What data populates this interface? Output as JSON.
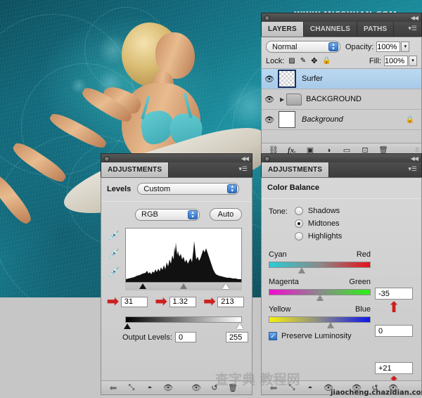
{
  "watermarks": {
    "top": "WWW.MISSYUAN.COM",
    "bottom": "jiaocheng.chazidian.com",
    "bottom_cn": "查字典 教程网"
  },
  "layers_panel": {
    "tabs": [
      {
        "label": "LAYERS",
        "active": true
      },
      {
        "label": "CHANNELS",
        "active": false
      },
      {
        "label": "PATHS",
        "active": false
      }
    ],
    "menu_icon": "panel-menu-icon",
    "blend_mode": "Normal",
    "opacity_label": "Opacity:",
    "opacity_value": "100%",
    "lock_label": "Lock:",
    "lock_icons": [
      "lock-transparency-icon",
      "lock-image-icon",
      "lock-position-icon",
      "lock-all-icon"
    ],
    "fill_label": "Fill:",
    "fill_value": "100%",
    "layers": [
      {
        "name": "Surfer",
        "type": "image",
        "selected": true,
        "visible": true,
        "locked": false,
        "italic": false
      },
      {
        "name": "BACKGROUND",
        "type": "group",
        "selected": false,
        "visible": true,
        "locked": false,
        "italic": false
      },
      {
        "name": "Background",
        "type": "image",
        "selected": false,
        "visible": true,
        "locked": true,
        "italic": true
      }
    ],
    "toolbar_icons": [
      "link-layers-icon",
      "layer-style-fx-icon",
      "add-layer-mask-icon",
      "new-adjustment-layer-icon",
      "new-group-icon",
      "new-layer-icon",
      "delete-layer-icon"
    ]
  },
  "levels_panel": {
    "tab_label": "ADJUSTMENTS",
    "menu_icon": "panel-menu-icon",
    "title": "Levels",
    "preset": "Custom",
    "channel": "RGB",
    "auto_label": "Auto",
    "eyedroppers": [
      "set-black-point-icon",
      "set-gray-point-icon",
      "set-white-point-icon"
    ],
    "input_shadow": "31",
    "input_midtone": "1.32",
    "input_highlight": "213",
    "output_label": "Output Levels:",
    "output_black": "0",
    "output_white": "255",
    "arrows": [
      "red-arrow-shadow",
      "red-arrow-midtone",
      "red-arrow-highlight"
    ],
    "toolbar_icons": [
      "return-to-adjustment-list-icon",
      "clip-to-layer-icon",
      "toggle-mask-icon",
      "preview-eye-icon",
      "view-previous-state-icon",
      "reset-icon",
      "delete-adjustment-icon"
    ]
  },
  "color_balance_panel": {
    "tab_label": "ADJUSTMENTS",
    "menu_icon": "panel-menu-icon",
    "title": "Color Balance",
    "tone_label": "Tone:",
    "tones": [
      {
        "label": "Shadows",
        "selected": false
      },
      {
        "label": "Midtones",
        "selected": true
      },
      {
        "label": "Highlights",
        "selected": false
      }
    ],
    "sliders": [
      {
        "left_label": "Cyan",
        "right_label": "Red",
        "value": "-35",
        "knob_pct": 32,
        "left_color": "#28cdd6",
        "right_color": "#e8111a",
        "arrow": true
      },
      {
        "left_label": "Magenta",
        "right_label": "Green",
        "value": "0",
        "knob_pct": 50,
        "left_color": "#f40ad2",
        "right_color": "#2ff018",
        "arrow": false
      },
      {
        "left_label": "Yellow",
        "right_label": "Blue",
        "value": "+21",
        "knob_pct": 61,
        "left_color": "#f6f00c",
        "right_color": "#1016e8",
        "arrow": true
      }
    ],
    "preserve_luminosity_label": "Preserve Luminosity",
    "preserve_luminosity_checked": true,
    "toolbar_icons": [
      "return-to-adjustment-list-icon",
      "clip-to-layer-icon",
      "toggle-mask-icon",
      "preview-eye-icon",
      "view-previous-state-icon",
      "reset-icon",
      "delete-adjustment-icon"
    ]
  },
  "colors": {
    "accent_blue": "#2f6fc4",
    "arrow_red": "#cc2020",
    "panel_bg": "#d0d0d0",
    "selection_blue": "#aacee9"
  }
}
